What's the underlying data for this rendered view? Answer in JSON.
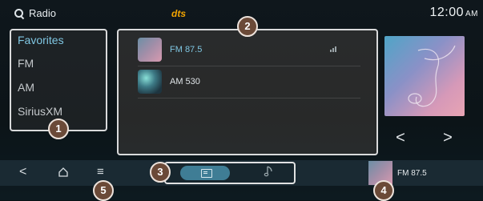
{
  "header": {
    "title": "Radio",
    "brand": "dts",
    "time": "12:00",
    "ampm": "AM"
  },
  "sources": [
    {
      "label": "Favorites",
      "active": true
    },
    {
      "label": "FM"
    },
    {
      "label": "AM"
    },
    {
      "label": "SiriusXM"
    }
  ],
  "stations": [
    {
      "name": "FM 87.5",
      "active": true
    },
    {
      "name": "AM 530"
    }
  ],
  "nav": {
    "back": "<",
    "menu": "≡"
  },
  "player": {
    "prev": "<",
    "next": ">",
    "now_playing": "FM 87.5"
  },
  "callouts": [
    "1",
    "2",
    "3",
    "4",
    "5"
  ],
  "colors": {
    "accent": "#7fc6e2",
    "callout": "#6b4a38",
    "brand": "#f2a400"
  }
}
